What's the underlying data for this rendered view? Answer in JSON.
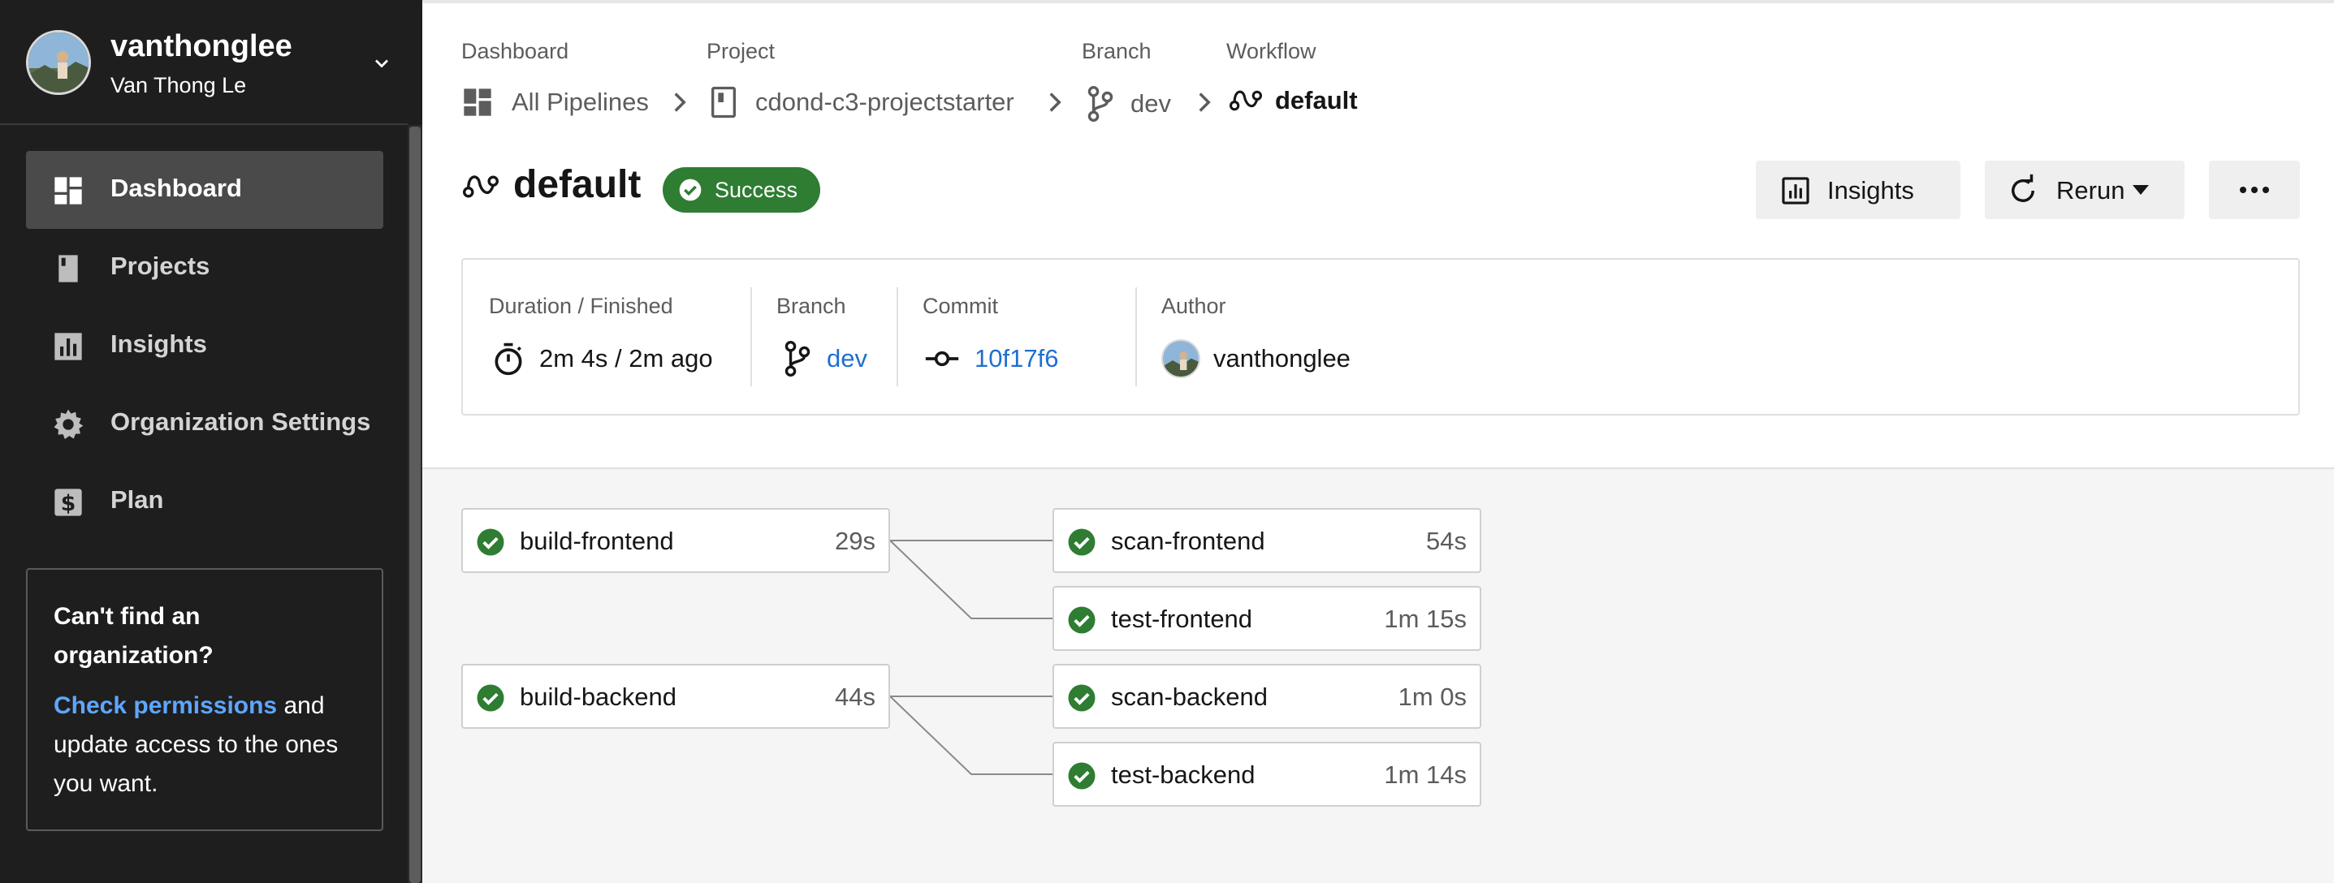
{
  "user": {
    "username": "vanthonglee",
    "full_name": "Van Thong Le"
  },
  "nav": {
    "items": [
      {
        "label": "Dashboard",
        "icon": "dashboard-icon",
        "active": true
      },
      {
        "label": "Projects",
        "icon": "projects-icon",
        "active": false
      },
      {
        "label": "Insights",
        "icon": "insights-icon",
        "active": false
      },
      {
        "label": "Organization Settings",
        "icon": "gear-icon",
        "active": false
      },
      {
        "label": "Plan",
        "icon": "plan-dollar-icon",
        "active": false
      }
    ]
  },
  "help": {
    "title": "Can't find an organization?",
    "link": "Check permissions",
    "rest": " and update access to the ones you want."
  },
  "breadcrumb": {
    "dashboard": {
      "label": "Dashboard",
      "value": "All Pipelines"
    },
    "project": {
      "label": "Project",
      "value": "cdond-c3-projectstarter"
    },
    "branch": {
      "label": "Branch",
      "value": "dev"
    },
    "workflow": {
      "label": "Workflow",
      "value": "default"
    }
  },
  "header": {
    "title": "default",
    "status": "Success",
    "insights_button": "Insights",
    "rerun_button": "Rerun",
    "more_button": "more-horizontal-icon"
  },
  "meta": {
    "duration": {
      "label": "Duration / Finished",
      "value": "2m 4s / 2m ago"
    },
    "branch": {
      "label": "Branch",
      "value": "dev"
    },
    "commit": {
      "label": "Commit",
      "value": "10f17f6"
    },
    "author": {
      "label": "Author",
      "value": "vanthonglee"
    }
  },
  "jobs": {
    "build_frontend": {
      "name": "build-frontend",
      "duration": "29s",
      "status": "success"
    },
    "scan_frontend": {
      "name": "scan-frontend",
      "duration": "54s",
      "status": "success"
    },
    "test_frontend": {
      "name": "test-frontend",
      "duration": "1m 15s",
      "status": "success"
    },
    "build_backend": {
      "name": "build-backend",
      "duration": "44s",
      "status": "success"
    },
    "scan_backend": {
      "name": "scan-backend",
      "duration": "1m 0s",
      "status": "success"
    },
    "test_backend": {
      "name": "test-backend",
      "duration": "1m 14s",
      "status": "success"
    }
  },
  "colors": {
    "success": "#2e7d32",
    "link": "#1f6fd1",
    "sidebar_bg": "#1e1e1e",
    "sidebar_active": "#4a4a4a",
    "help_link": "#5ea6ff"
  }
}
